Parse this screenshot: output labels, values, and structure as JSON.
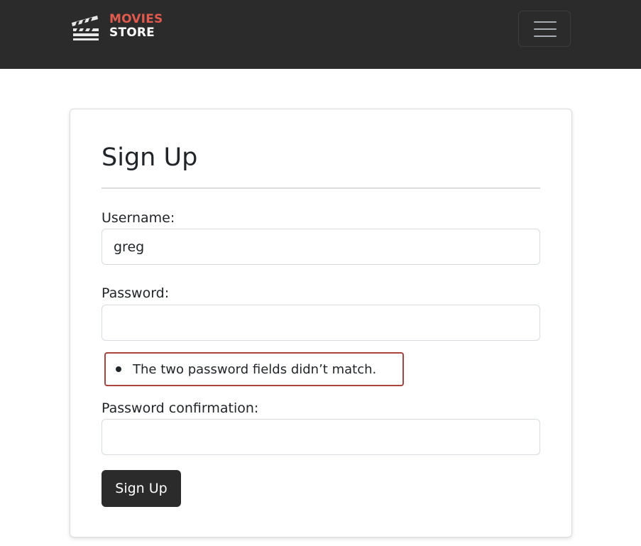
{
  "navbar": {
    "brand_top": "MOVIES",
    "brand_bottom": "STORE",
    "logo_icon": "clapperboard-icon",
    "menu_icon": "hamburger-menu-icon"
  },
  "form": {
    "title": "Sign Up",
    "username_label": "Username:",
    "username_value": "greg",
    "password_label": "Password:",
    "password_value": "",
    "errors": [
      "The two password fields didn’t match."
    ],
    "confirm_label": "Password confirmation:",
    "confirm_value": "",
    "submit_label": "Sign Up"
  },
  "colors": {
    "navbar_bg": "#2b2b2b",
    "brand_accent": "#e05a4e",
    "error_outline": "#a8453c",
    "button_bg": "#2b2b2b"
  }
}
